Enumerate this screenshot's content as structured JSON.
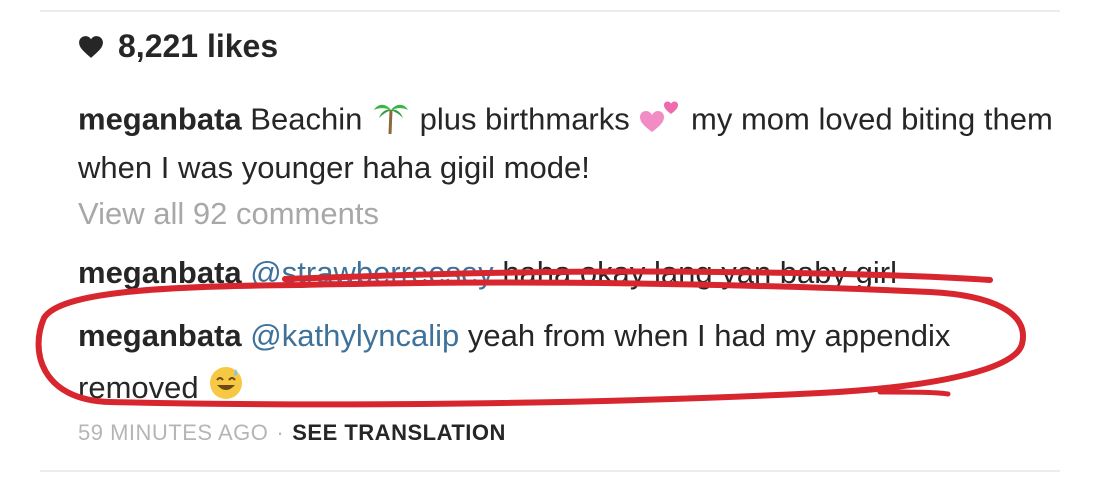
{
  "post": {
    "likes": "8,221 likes",
    "caption": {
      "username": "meganbata",
      "text_part1": "Beachin",
      "emoji1": "palm-tree-icon",
      "text_part2": "plus birthmarks",
      "emoji2": "two-hearts-icon",
      "text_part3": "my mom loved biting them when I was younger haha gigil mode!"
    },
    "view_all_comments": "View all 92 comments"
  },
  "comments": [
    {
      "username": "meganbata",
      "mention": "@strawberreesey",
      "text": "haha okay lang yan baby girl"
    },
    {
      "username": "meganbata",
      "mention": "@kathylyncalip",
      "text": "yeah from when I had my appendix removed",
      "emoji": "grinning-sweat-face-icon"
    }
  ],
  "meta": {
    "time": "59 MINUTES AGO",
    "separator": "·",
    "see_translation": "SEE TRANSLATION"
  },
  "colors": {
    "mention": "#3f729b",
    "muted": "#a8a8a8",
    "annotation_red": "#d8262e"
  }
}
